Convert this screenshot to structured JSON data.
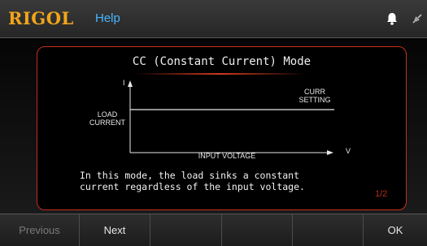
{
  "header": {
    "brand": "RIGOL",
    "title": "Help"
  },
  "help_panel": {
    "mode_title": "CC (Constant Current) Mode",
    "graph": {
      "y_axis_label": "I",
      "x_axis_label": "V",
      "left_label_line1": "LOAD",
      "left_label_line2": "CURRENT",
      "curve_label_line1": "CURR",
      "curve_label_line2": "SETTING",
      "x_caption": "INPUT VOLTAGE"
    },
    "description_line1": "In this mode, the load sinks a constant",
    "description_line2": "current regardless of the input voltage.",
    "page_indicator": "1/2"
  },
  "softkeys": {
    "previous": "Previous",
    "next": "Next",
    "ok": "OK"
  },
  "colors": {
    "brand": "#f2a51a",
    "title": "#47b6ff",
    "accent": "#c2301d"
  },
  "icons": [
    "bell-icon",
    "usb-plug-icon"
  ]
}
